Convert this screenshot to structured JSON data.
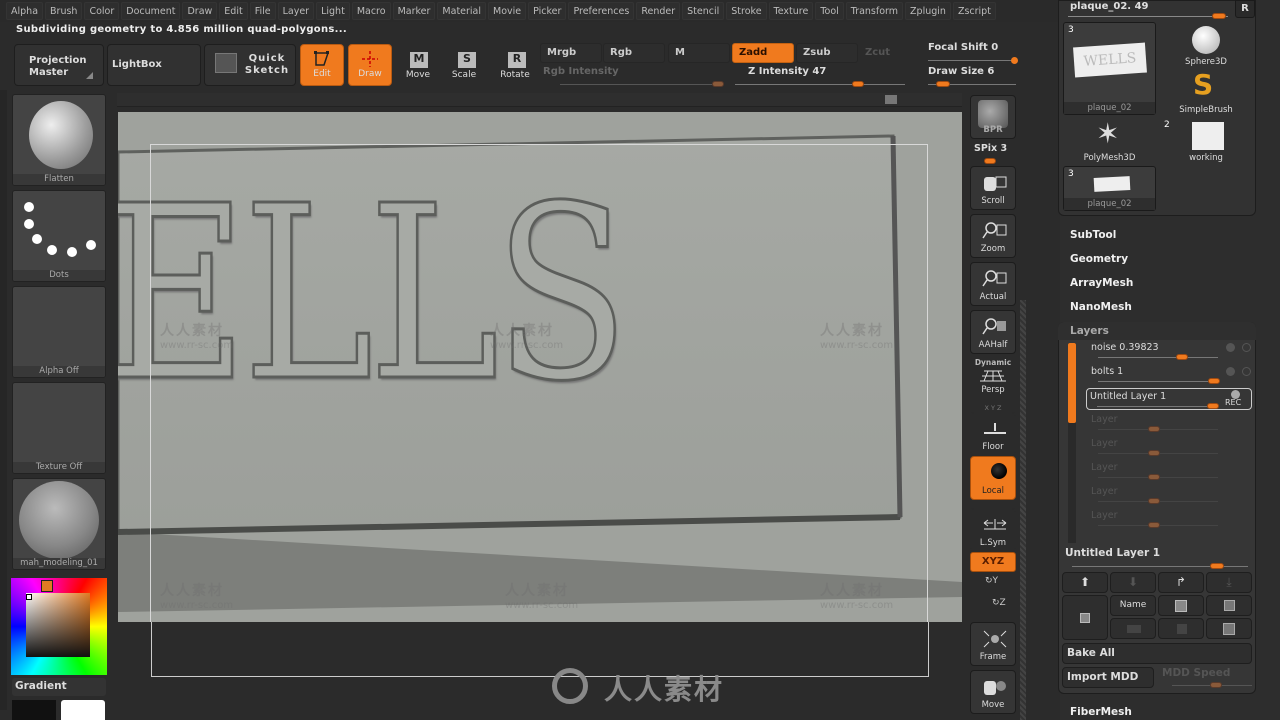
{
  "menu": [
    "Alpha",
    "Brush",
    "Color",
    "Document",
    "Draw",
    "Edit",
    "File",
    "Layer",
    "Light",
    "Macro",
    "Marker",
    "Material",
    "Movie",
    "Picker",
    "Preferences",
    "Render",
    "Stencil",
    "Stroke",
    "Texture",
    "Tool",
    "Transform",
    "Zplugin",
    "Zscript"
  ],
  "status_message": "Subdividing geometry to 4.856 million quad-polygons...",
  "toolbar": {
    "projection_master": "Projection Master",
    "lightbox": "LightBox",
    "quick_sketch": "Quick Sketch",
    "edit": "Edit",
    "draw": "Draw",
    "move": "Move",
    "scale": "Scale",
    "rotate": "Rotate",
    "mrgb": "Mrgb",
    "rgb": "Rgb",
    "m": "M",
    "zadd": "Zadd",
    "zsub": "Zsub",
    "zcut": "Zcut",
    "rgb_intensity_label": "Rgb Intensity",
    "z_intensity_label": "Z Intensity 47",
    "z_intensity_value": 47,
    "focal_shift_label": "Focal Shift 0",
    "focal_shift_value": 0,
    "draw_size_label": "Draw Size 6",
    "draw_size_value": 6
  },
  "left_shelf": {
    "brush": "Flatten",
    "stroke": "Dots",
    "alpha": "Alpha Off",
    "texture": "Texture Off",
    "material": "mah_modeling_01",
    "gradient": "Gradient",
    "main_color": "#e07a22"
  },
  "viewport": {
    "model_text": "ELLS"
  },
  "right_shelf": {
    "bpr": "BPR",
    "spix": "SPix 3",
    "scroll": "Scroll",
    "zoom": "Zoom",
    "actual": "Actual",
    "aahalf": "AAHalf",
    "dynamic": "Dynamic",
    "persp": "Persp",
    "xyz_small": "X Y Z",
    "floor": "Floor",
    "local": "Local",
    "lsym": "L.Sym",
    "xyz": "XYZ",
    "y": "Y",
    "z": "Z",
    "frame": "Frame",
    "move": "Move"
  },
  "tool_panel": {
    "current_tool": "plaque_02. 49",
    "r_button": "R",
    "tools": [
      {
        "name": "plaque_02",
        "count": "3"
      },
      {
        "name": "Sphere3D",
        "count": ""
      },
      {
        "name": "SimpleBrush",
        "count": ""
      },
      {
        "name": "PolyMesh3D",
        "count": ""
      },
      {
        "name": "working",
        "count": "2"
      },
      {
        "name": "plaque_02",
        "count": "3"
      }
    ],
    "sections": [
      "SubTool",
      "Geometry",
      "ArrayMesh",
      "NanoMesh"
    ],
    "layers_title": "Layers",
    "layers": [
      {
        "name": "noise 0.39823",
        "active": true
      },
      {
        "name": "bolts 1",
        "active": true
      },
      {
        "name": "Untitled Layer 1",
        "active": true,
        "rec": "REC"
      },
      {
        "name": "Layer",
        "active": false
      },
      {
        "name": "Layer",
        "active": false
      },
      {
        "name": "Layer",
        "active": false
      },
      {
        "name": "Layer",
        "active": false
      },
      {
        "name": "Layer",
        "active": false
      }
    ],
    "selected_layer": "Untitled Layer 1",
    "name_button": "Name",
    "bake_all": "Bake All",
    "import_mdd": "Import MDD",
    "mdd_speed": "MDD Speed",
    "fibermesh": "FiberMesh"
  },
  "watermark": {
    "cn": "人人素材",
    "url": "www.rr-sc.com"
  }
}
